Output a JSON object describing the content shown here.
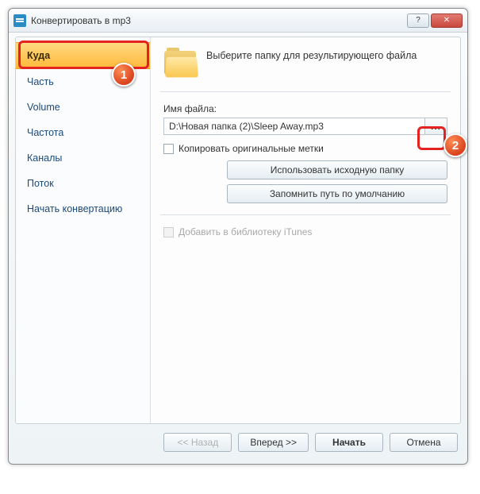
{
  "window": {
    "title": "Конвертировать в mp3"
  },
  "sidebar": {
    "items": [
      {
        "label": "Куда",
        "selected": true
      },
      {
        "label": "Часть",
        "selected": false
      },
      {
        "label": "Volume",
        "selected": false
      },
      {
        "label": "Частота",
        "selected": false
      },
      {
        "label": "Каналы",
        "selected": false
      },
      {
        "label": "Поток",
        "selected": false
      },
      {
        "label": "Начать конвертацию",
        "selected": false
      }
    ]
  },
  "content": {
    "header": "Выберите папку для результирующего файла",
    "filename_label": "Имя файла:",
    "filename_value": "D:\\Новая папка (2)\\Sleep Away.mp3",
    "browse_glyph": "...",
    "copy_tags_label": "Копировать оригинальные метки",
    "copy_tags_checked": false,
    "use_source_folder_label": "Использовать исходную папку",
    "remember_default_label": "Запомнить путь по умолчанию",
    "add_itunes_label": "Добавить в библиотеку iTunes",
    "add_itunes_enabled": false
  },
  "footer": {
    "back": "<< Назад",
    "forward": "Вперед >>",
    "start": "Начать",
    "cancel": "Отмена"
  },
  "annotations": {
    "badge1": "1",
    "badge2": "2"
  }
}
